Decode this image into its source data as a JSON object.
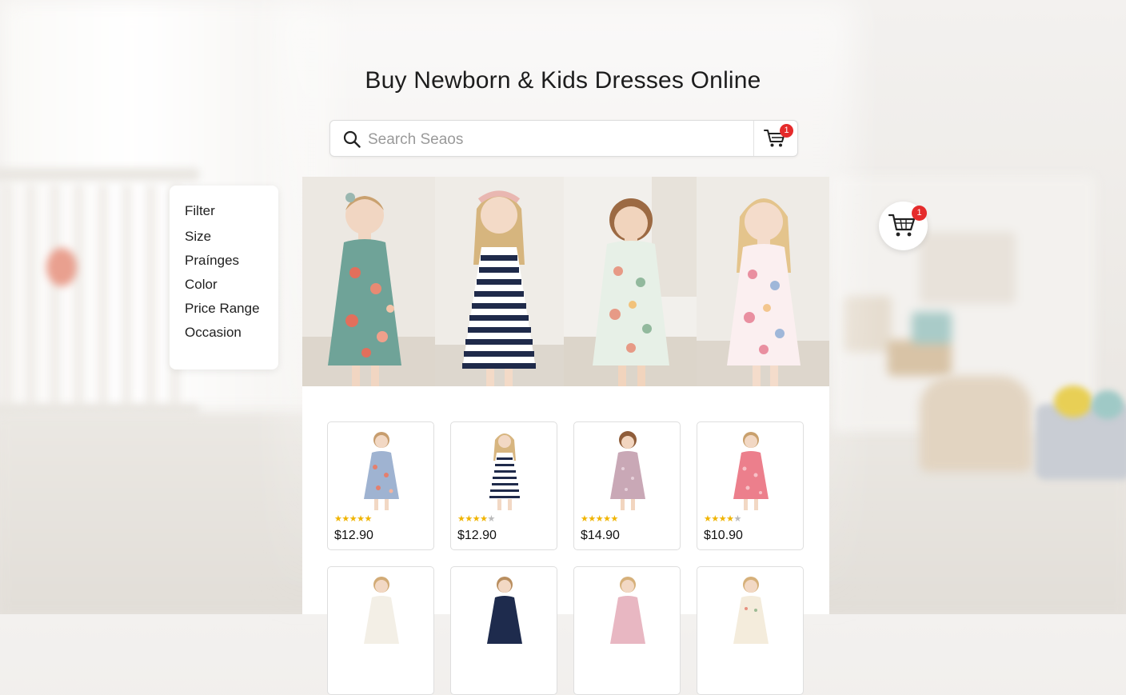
{
  "page": {
    "title": "Buy Newborn & Kids Dresses Online"
  },
  "search": {
    "placeholder": "Search Seaos",
    "cart_badge": "1"
  },
  "floating_cart": {
    "badge": "1"
  },
  "filters": {
    "items": [
      "Filter",
      "Size",
      "Praínges",
      "Color",
      "Price Range",
      "Occasion"
    ]
  },
  "hero": {
    "dresses": [
      "teal-floral",
      "navy-stripe",
      "mint-floral",
      "pink-floral"
    ]
  },
  "products": [
    {
      "price": "$12.90",
      "rating": 5,
      "dress": "blue-floral"
    },
    {
      "price": "$12.90",
      "rating": 4,
      "dress": "navy-stripe"
    },
    {
      "price": "$14.90",
      "rating": 4.5,
      "dress": "mauve"
    },
    {
      "price": "$10.90",
      "rating": 4,
      "dress": "coral-pink"
    },
    {
      "dress": "ivory"
    },
    {
      "dress": "navy"
    },
    {
      "dress": "pink"
    },
    {
      "dress": "cream-floral"
    }
  ],
  "colors": {
    "badge": "#e52b2b",
    "star": "#f0b400"
  }
}
